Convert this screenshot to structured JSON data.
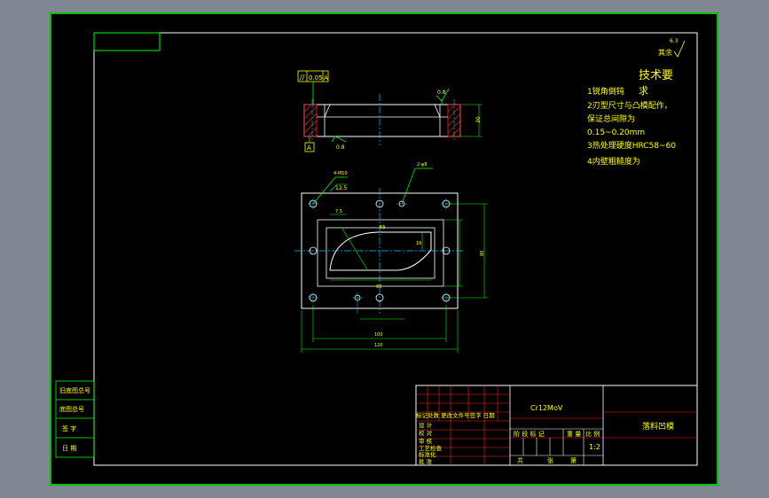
{
  "colors": {
    "background": "#000000",
    "frame_outer": "#00ff00",
    "frame_inner": "#ffffff",
    "part": "#ffffff",
    "dimension": "#00ff00",
    "centerline": "#00c8ff",
    "text": "#ffff00",
    "title_block_red": "#ff2020",
    "surround": "#7f8793"
  },
  "tech_requirements": {
    "roughness_top": "6.3",
    "roughness_rest": "其余",
    "title": "技术要",
    "title_cont": "求",
    "items": [
      "1锐角倒钝",
      "2刃型尺寸与凸模配作，",
      "保证总间隙为",
      "0.15~0.20mm",
      "3热处理硬度HRC58~60",
      "4内壁粗糙度为"
    ]
  },
  "section_view": {
    "gdt_value": "0.05",
    "gdt_datum": "A",
    "datum_label": "A",
    "roughness_right": "0.8",
    "roughness_bottom": "0.8",
    "height_dim": "30"
  },
  "plan_view": {
    "hole_note": "4-M10",
    "hole_dim": "12.5",
    "pin_note": "2-φ8",
    "dim_radius": "R5",
    "dim_small": "7.5",
    "dim_height_inner": "16",
    "dim_width_inner": "60",
    "dim_width_mid": "100",
    "dim_width_outer": "120",
    "dim_height_outer": "80"
  },
  "left_strip": {
    "rows": [
      "旧底图总号",
      "底图总号",
      "签 字",
      "日 期"
    ]
  },
  "title_block": {
    "material": "Cr12MoV",
    "part_name": "落料凹模",
    "header_row": "标记处数 更改文件号签字 日期",
    "left_rows": [
      "设 计",
      "校 对",
      "审 核",
      "工艺检查",
      "标准化",
      "批 准"
    ],
    "stage_label": "阶 段 标 记",
    "weight_label": "重 量",
    "scale_label": "比 例",
    "scale_value": "1:2",
    "sheet_total": "共",
    "sheet_num": "第",
    "sheet_unit": "张"
  }
}
